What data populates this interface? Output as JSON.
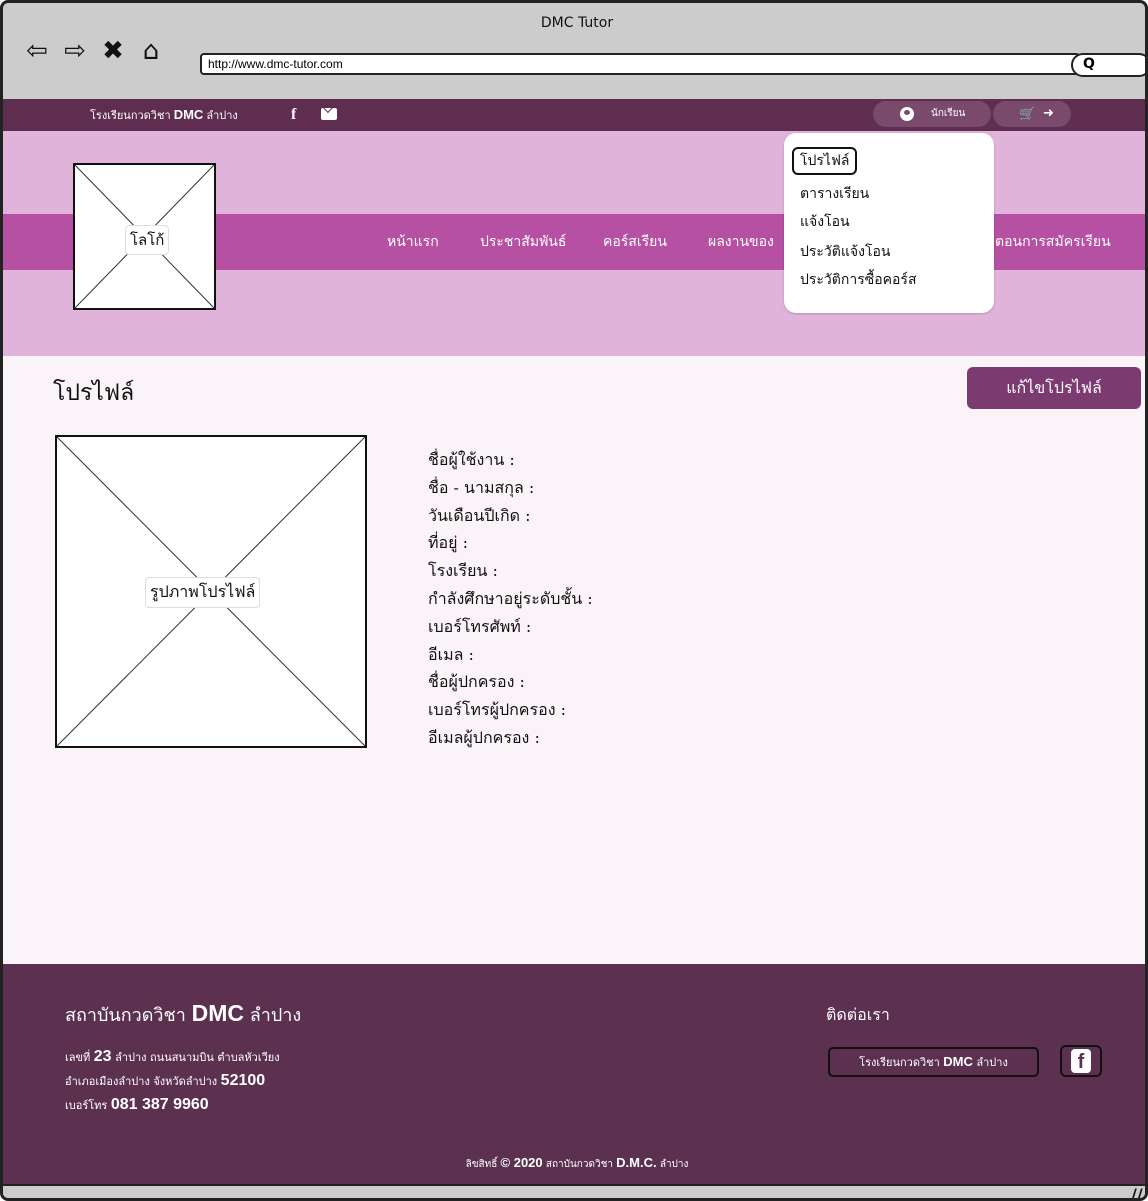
{
  "window": {
    "title": "DMC Tutor"
  },
  "browser": {
    "back": "⇦",
    "forward": "⇨",
    "stop": "✖",
    "home": "⌂",
    "url": "http://www.dmc-tutor.com",
    "search_glyph": "Q"
  },
  "topbar": {
    "school_prefix": "โรงเรียนกวดวิชา",
    "school_brand": "DMC",
    "school_suffix": "ลำปาง",
    "facebook_glyph": "f",
    "user_label": "นักเรียน",
    "cart_glyph": "🛒",
    "logout_glyph": "➜"
  },
  "header": {
    "logo_label": "โลโก้",
    "nav": [
      "หน้าแรก",
      "ประชาสัมพันธ์",
      "คอร์สเรียน",
      "ผลงานของ",
      "ตอนการสมัครเรียน"
    ]
  },
  "dropdown": {
    "items": [
      "โปรไฟล์",
      "ตารางเรียน",
      "แจ้งโอน",
      "ประวัติแจ้งโอน",
      "ประวัติการซื้อคอร์ส"
    ]
  },
  "main": {
    "title": "โปรไฟล์",
    "edit_button": "แก้ไขโปรไฟล์",
    "photo_label": "รูปภาพโปรไฟล์",
    "fields": [
      "ชื่อผู้ใช้งาน :",
      "ชื่อ - นามสกุล :",
      "วันเดือนปีเกิด :",
      "ที่อยู่ :",
      "โรงเรียน :",
      "กำลังศึกษาอยู่ระดับชั้น :",
      "เบอร์โทรศัพท์ :",
      "อีเมล :",
      "ชื่อผู้ปกครอง :",
      "เบอร์โทรผู้ปกครอง :",
      "อีเมลผู้ปกครอง :"
    ]
  },
  "footer": {
    "name_prefix": "สถาบันกวดวิชา",
    "name_brand": "DMC",
    "name_suffix": "ลำปาง",
    "addr1_prefix": "เลขที่",
    "addr1_num": "23",
    "addr1_rest": "ลำปาง ถนนสนามบิน ตำบลหัวเวียง",
    "addr2_prefix": "อำเภอเมืองลำปาง จังหวัดลำปาง",
    "addr2_zip": "52100",
    "addr3_prefix": "เบอร์โทร",
    "addr3_phone": "081 387 9960",
    "contact_title": "ติดต่อเรา",
    "contact_btn_prefix": "โรงเรียนกวดวิชา",
    "contact_btn_brand": "DMC",
    "contact_btn_suffix": "ลำปาง",
    "fb_glyph": "f",
    "copyright_prefix": "ลิขสิทธิ์",
    "copyright_year": "© 2020",
    "copyright_mid": "สถาบันกวดวิชา",
    "copyright_brand": "D.M.C.",
    "copyright_suffix": "ลำปาง"
  }
}
